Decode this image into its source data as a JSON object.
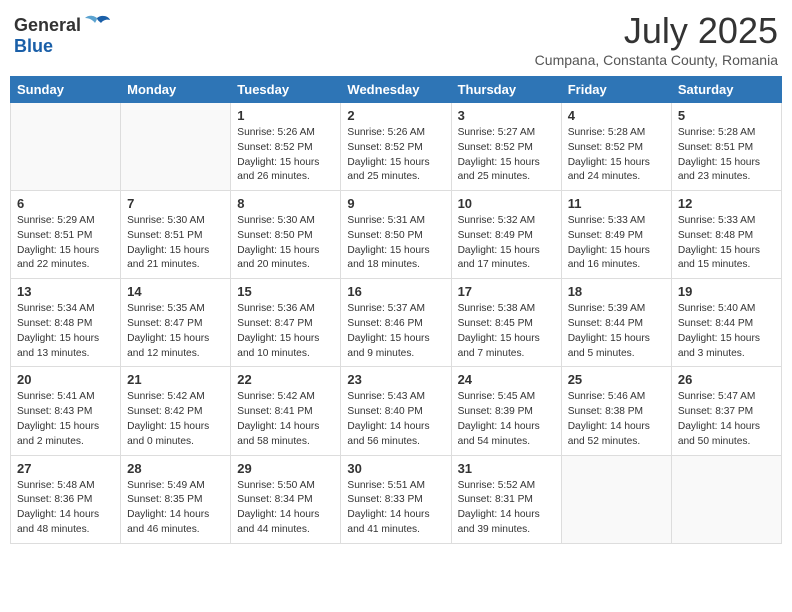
{
  "logo": {
    "general": "General",
    "blue": "Blue"
  },
  "title": {
    "month_year": "July 2025",
    "location": "Cumpana, Constanta County, Romania"
  },
  "weekdays": [
    "Sunday",
    "Monday",
    "Tuesday",
    "Wednesday",
    "Thursday",
    "Friday",
    "Saturday"
  ],
  "weeks": [
    [
      {
        "day": "",
        "info": ""
      },
      {
        "day": "",
        "info": ""
      },
      {
        "day": "1",
        "info": "Sunrise: 5:26 AM\nSunset: 8:52 PM\nDaylight: 15 hours and 26 minutes."
      },
      {
        "day": "2",
        "info": "Sunrise: 5:26 AM\nSunset: 8:52 PM\nDaylight: 15 hours and 25 minutes."
      },
      {
        "day": "3",
        "info": "Sunrise: 5:27 AM\nSunset: 8:52 PM\nDaylight: 15 hours and 25 minutes."
      },
      {
        "day": "4",
        "info": "Sunrise: 5:28 AM\nSunset: 8:52 PM\nDaylight: 15 hours and 24 minutes."
      },
      {
        "day": "5",
        "info": "Sunrise: 5:28 AM\nSunset: 8:51 PM\nDaylight: 15 hours and 23 minutes."
      }
    ],
    [
      {
        "day": "6",
        "info": "Sunrise: 5:29 AM\nSunset: 8:51 PM\nDaylight: 15 hours and 22 minutes."
      },
      {
        "day": "7",
        "info": "Sunrise: 5:30 AM\nSunset: 8:51 PM\nDaylight: 15 hours and 21 minutes."
      },
      {
        "day": "8",
        "info": "Sunrise: 5:30 AM\nSunset: 8:50 PM\nDaylight: 15 hours and 20 minutes."
      },
      {
        "day": "9",
        "info": "Sunrise: 5:31 AM\nSunset: 8:50 PM\nDaylight: 15 hours and 18 minutes."
      },
      {
        "day": "10",
        "info": "Sunrise: 5:32 AM\nSunset: 8:49 PM\nDaylight: 15 hours and 17 minutes."
      },
      {
        "day": "11",
        "info": "Sunrise: 5:33 AM\nSunset: 8:49 PM\nDaylight: 15 hours and 16 minutes."
      },
      {
        "day": "12",
        "info": "Sunrise: 5:33 AM\nSunset: 8:48 PM\nDaylight: 15 hours and 15 minutes."
      }
    ],
    [
      {
        "day": "13",
        "info": "Sunrise: 5:34 AM\nSunset: 8:48 PM\nDaylight: 15 hours and 13 minutes."
      },
      {
        "day": "14",
        "info": "Sunrise: 5:35 AM\nSunset: 8:47 PM\nDaylight: 15 hours and 12 minutes."
      },
      {
        "day": "15",
        "info": "Sunrise: 5:36 AM\nSunset: 8:47 PM\nDaylight: 15 hours and 10 minutes."
      },
      {
        "day": "16",
        "info": "Sunrise: 5:37 AM\nSunset: 8:46 PM\nDaylight: 15 hours and 9 minutes."
      },
      {
        "day": "17",
        "info": "Sunrise: 5:38 AM\nSunset: 8:45 PM\nDaylight: 15 hours and 7 minutes."
      },
      {
        "day": "18",
        "info": "Sunrise: 5:39 AM\nSunset: 8:44 PM\nDaylight: 15 hours and 5 minutes."
      },
      {
        "day": "19",
        "info": "Sunrise: 5:40 AM\nSunset: 8:44 PM\nDaylight: 15 hours and 3 minutes."
      }
    ],
    [
      {
        "day": "20",
        "info": "Sunrise: 5:41 AM\nSunset: 8:43 PM\nDaylight: 15 hours and 2 minutes."
      },
      {
        "day": "21",
        "info": "Sunrise: 5:42 AM\nSunset: 8:42 PM\nDaylight: 15 hours and 0 minutes."
      },
      {
        "day": "22",
        "info": "Sunrise: 5:42 AM\nSunset: 8:41 PM\nDaylight: 14 hours and 58 minutes."
      },
      {
        "day": "23",
        "info": "Sunrise: 5:43 AM\nSunset: 8:40 PM\nDaylight: 14 hours and 56 minutes."
      },
      {
        "day": "24",
        "info": "Sunrise: 5:45 AM\nSunset: 8:39 PM\nDaylight: 14 hours and 54 minutes."
      },
      {
        "day": "25",
        "info": "Sunrise: 5:46 AM\nSunset: 8:38 PM\nDaylight: 14 hours and 52 minutes."
      },
      {
        "day": "26",
        "info": "Sunrise: 5:47 AM\nSunset: 8:37 PM\nDaylight: 14 hours and 50 minutes."
      }
    ],
    [
      {
        "day": "27",
        "info": "Sunrise: 5:48 AM\nSunset: 8:36 PM\nDaylight: 14 hours and 48 minutes."
      },
      {
        "day": "28",
        "info": "Sunrise: 5:49 AM\nSunset: 8:35 PM\nDaylight: 14 hours and 46 minutes."
      },
      {
        "day": "29",
        "info": "Sunrise: 5:50 AM\nSunset: 8:34 PM\nDaylight: 14 hours and 44 minutes."
      },
      {
        "day": "30",
        "info": "Sunrise: 5:51 AM\nSunset: 8:33 PM\nDaylight: 14 hours and 41 minutes."
      },
      {
        "day": "31",
        "info": "Sunrise: 5:52 AM\nSunset: 8:31 PM\nDaylight: 14 hours and 39 minutes."
      },
      {
        "day": "",
        "info": ""
      },
      {
        "day": "",
        "info": ""
      }
    ]
  ]
}
